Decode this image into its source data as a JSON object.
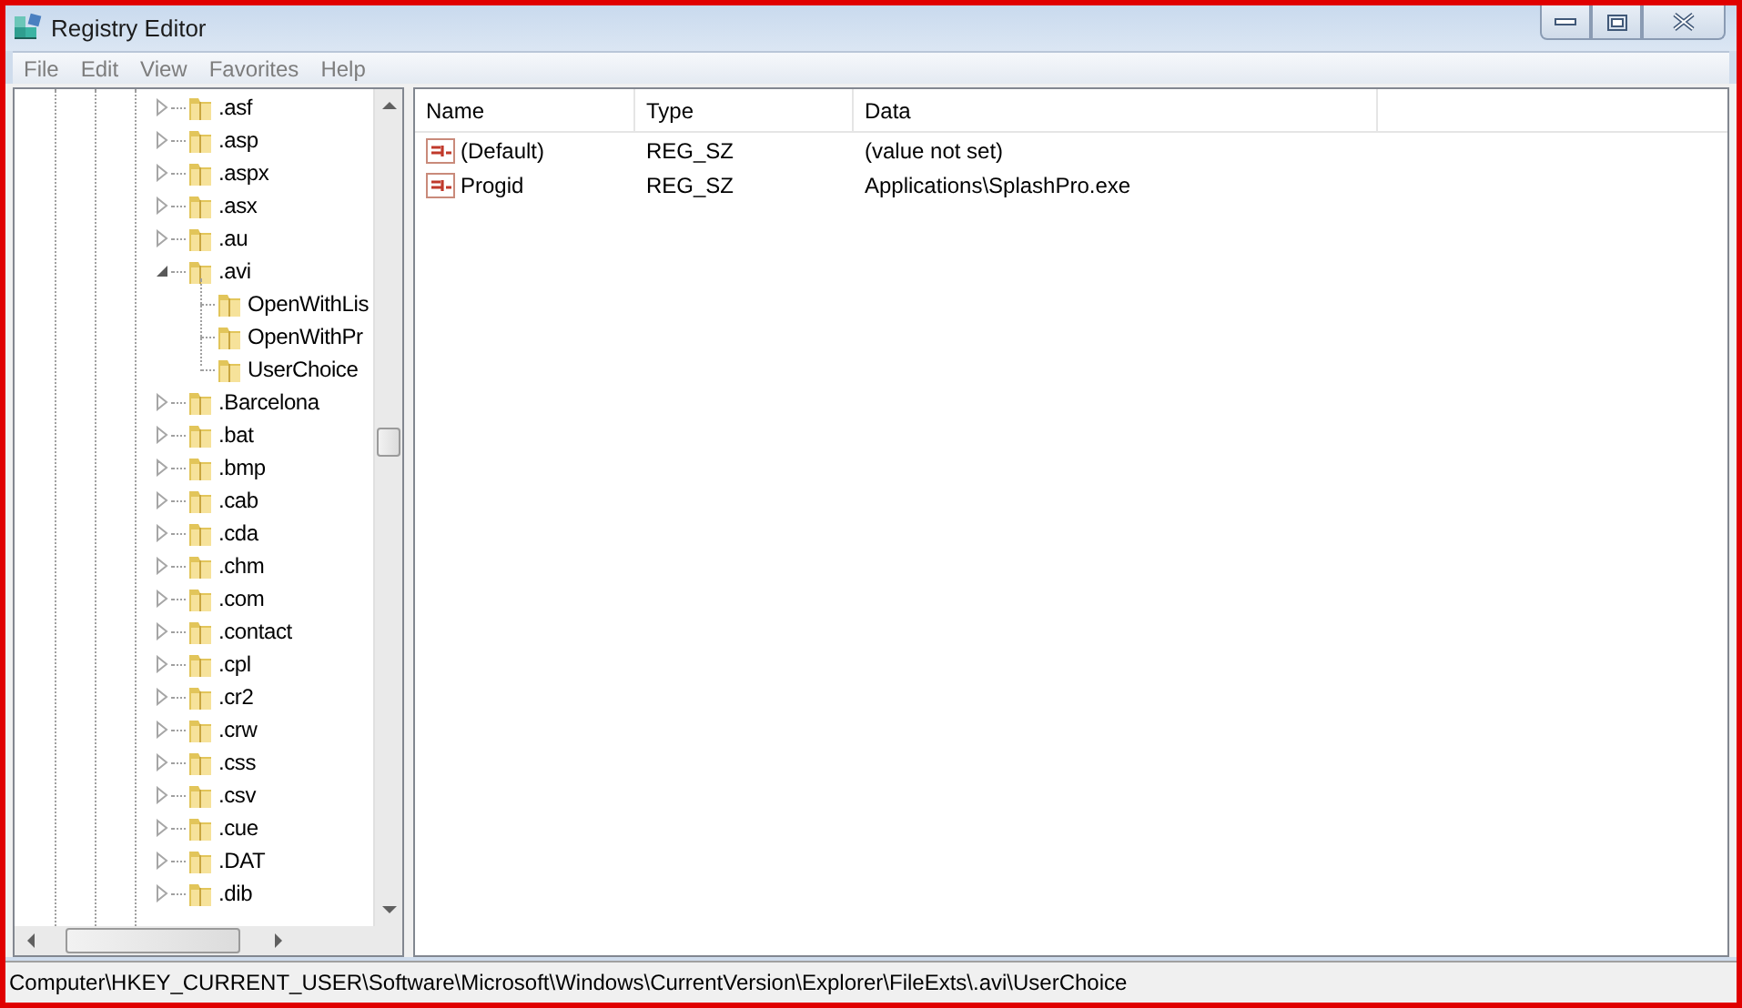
{
  "window": {
    "title": "Registry Editor"
  },
  "menu": [
    "File",
    "Edit",
    "View",
    "Favorites",
    "Help"
  ],
  "tree": {
    "items": [
      {
        "label": ".asf",
        "expanded": false
      },
      {
        "label": ".asp",
        "expanded": false
      },
      {
        "label": ".aspx",
        "expanded": false
      },
      {
        "label": ".asx",
        "expanded": false
      },
      {
        "label": ".au",
        "expanded": false
      },
      {
        "label": ".avi",
        "expanded": true,
        "children": [
          {
            "label": "OpenWithLis"
          },
          {
            "label": "OpenWithPr"
          },
          {
            "label": "UserChoice"
          }
        ]
      },
      {
        "label": ".Barcelona",
        "expanded": false
      },
      {
        "label": ".bat",
        "expanded": false
      },
      {
        "label": ".bmp",
        "expanded": false
      },
      {
        "label": ".cab",
        "expanded": false
      },
      {
        "label": ".cda",
        "expanded": false
      },
      {
        "label": ".chm",
        "expanded": false
      },
      {
        "label": ".com",
        "expanded": false
      },
      {
        "label": ".contact",
        "expanded": false
      },
      {
        "label": ".cpl",
        "expanded": false
      },
      {
        "label": ".cr2",
        "expanded": false
      },
      {
        "label": ".crw",
        "expanded": false
      },
      {
        "label": ".css",
        "expanded": false
      },
      {
        "label": ".csv",
        "expanded": false
      },
      {
        "label": ".cue",
        "expanded": false
      },
      {
        "label": ".DAT",
        "expanded": false
      },
      {
        "label": ".dib",
        "expanded": false
      }
    ]
  },
  "table": {
    "columns": [
      "Name",
      "Type",
      "Data"
    ],
    "rows": [
      {
        "name": "(Default)",
        "type": "REG_SZ",
        "data": "(value not set)"
      },
      {
        "name": "Progid",
        "type": "REG_SZ",
        "data": "Applications\\SplashPro.exe"
      }
    ]
  },
  "status_bar": "Computer\\HKEY_CURRENT_USER\\Software\\Microsoft\\Windows\\CurrentVersion\\Explorer\\FileExts\\.avi\\UserChoice"
}
